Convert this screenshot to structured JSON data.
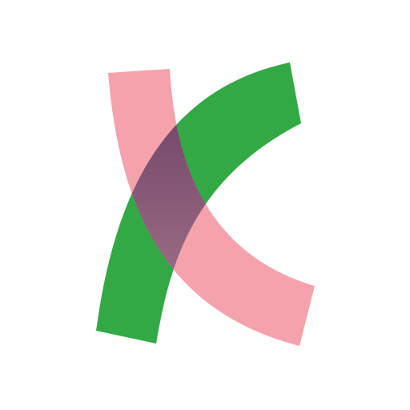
{
  "logo": {
    "icon_name": "k-letter-logo-icon",
    "colors": {
      "background": "#ffffff",
      "green": "#33a945",
      "pink": "#f4a3ad",
      "overlap_top": "#6b3d63",
      "overlap_bottom": "#a97b8e"
    }
  }
}
